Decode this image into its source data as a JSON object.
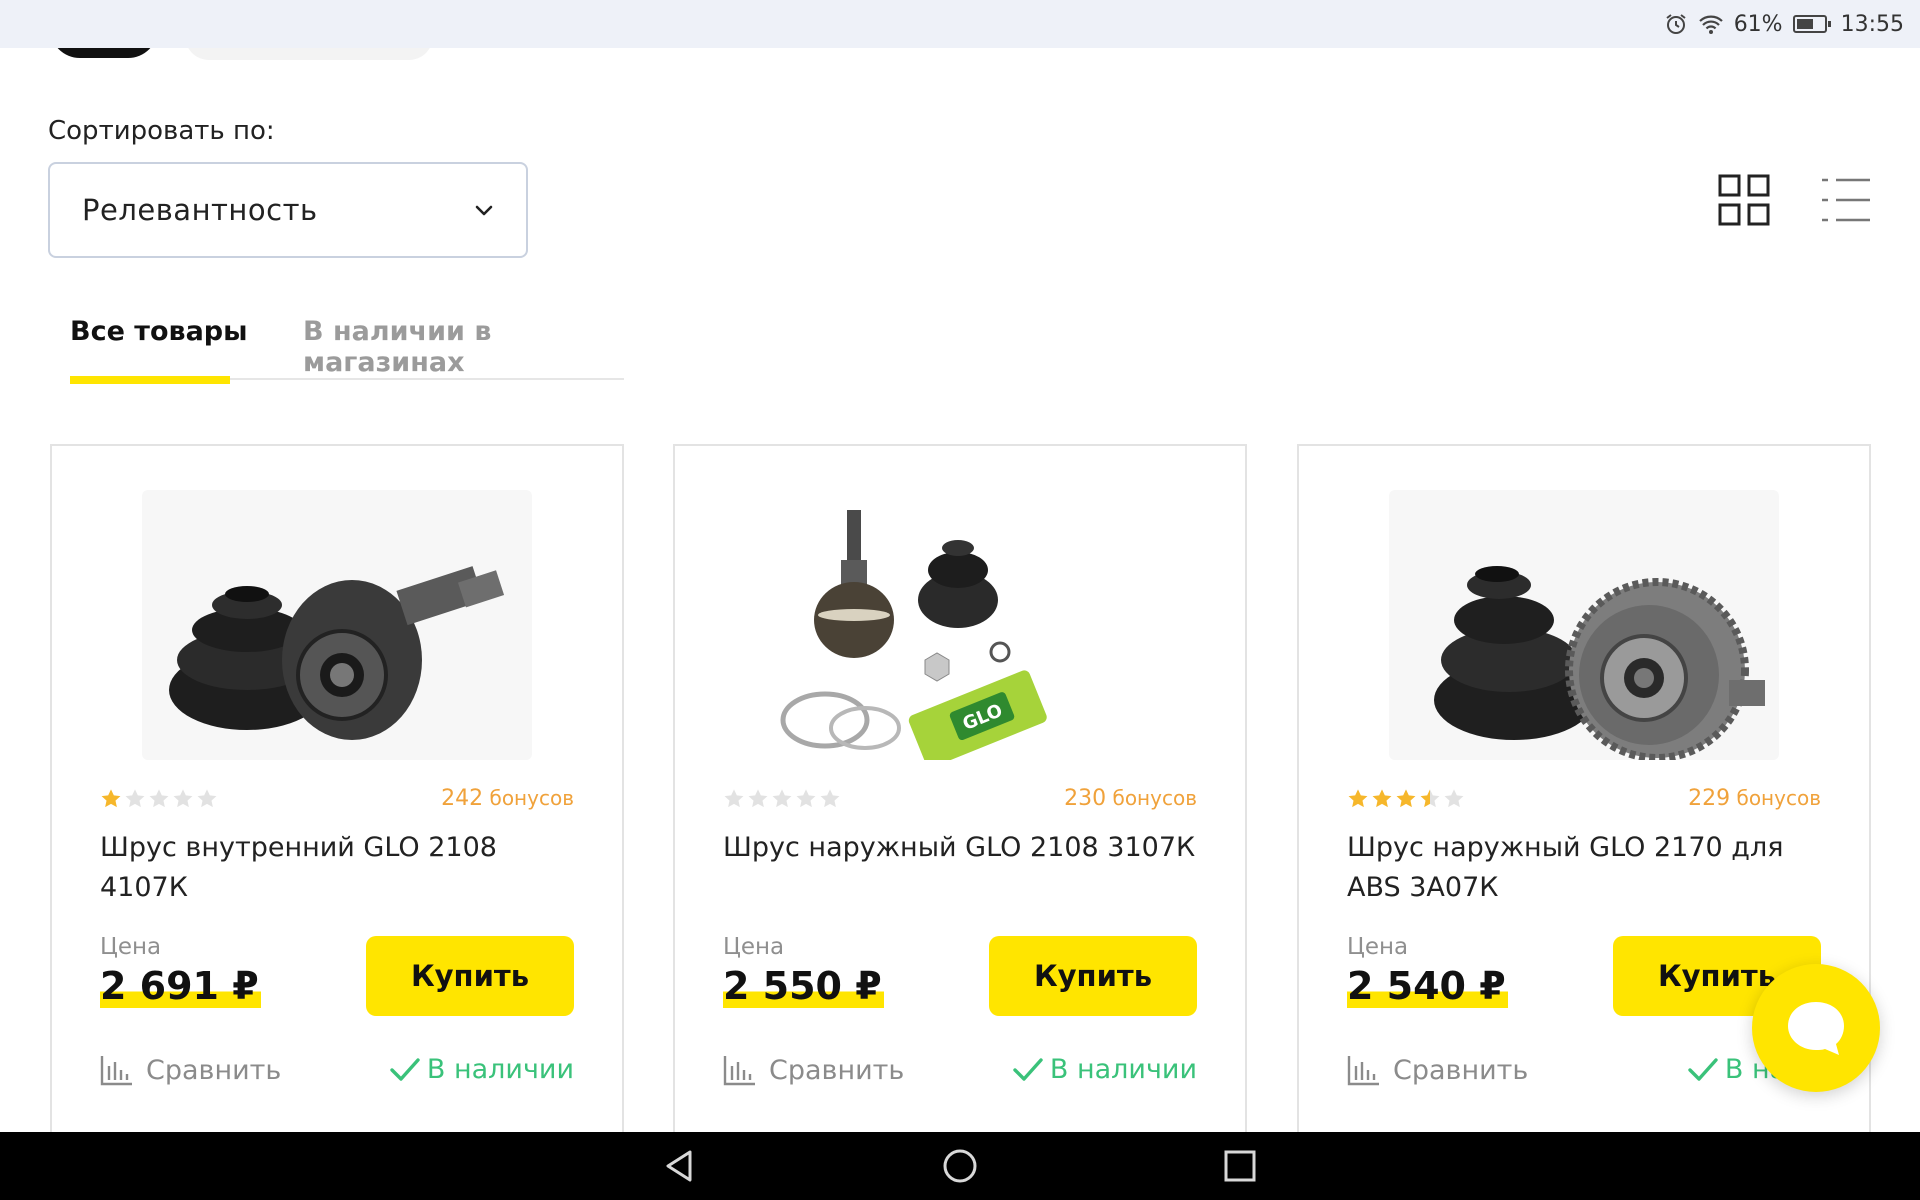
{
  "status_bar": {
    "battery_text": "61%",
    "battery_level": 0.61,
    "time": "13:55",
    "icons": [
      "alarm-icon",
      "wifi-icon",
      "battery-icon"
    ]
  },
  "sort": {
    "label": "Сортировать по:",
    "selected": "Релевантность"
  },
  "view_toggle": {
    "options": [
      "grid-view-icon",
      "list-view-icon"
    ],
    "active": "grid"
  },
  "tabs": [
    {
      "label": "Все товары",
      "active": true
    },
    {
      "label": "В наличии в магазинах",
      "active": false
    }
  ],
  "products": [
    {
      "rating": 1,
      "bonus_value": "242",
      "bonus_unit": "бонусов",
      "title": "Шрус внутренний GLO 2108 4107К",
      "price_label": "Цена",
      "price": "2 691 ₽",
      "buy_label": "Купить",
      "compare_label": "Сравнить",
      "stock_label": "В наличии"
    },
    {
      "rating": 0,
      "bonus_value": "230",
      "bonus_unit": "бонусов",
      "title": "Шрус наружный GLO 2108 3107К",
      "price_label": "Цена",
      "price": "2 550 ₽",
      "buy_label": "Купить",
      "compare_label": "Сравнить",
      "stock_label": "В наличии"
    },
    {
      "rating": 3.5,
      "bonus_value": "229",
      "bonus_unit": "бонусов",
      "title": "Шрус наружный GLO 2170 для ABS 3А07К",
      "price_label": "Цена",
      "price": "2 540 ₽",
      "buy_label": "Купить",
      "compare_label": "Сравнить",
      "stock_label": "В нали"
    }
  ],
  "colors": {
    "accent": "#ffe500",
    "bonus": "#f0a23b",
    "in_stock": "#3ac27a",
    "star_filled": "#f6b72b",
    "star_empty": "#e2e2e2"
  },
  "nav_bar": {
    "icons": [
      "back-icon",
      "home-icon",
      "recents-icon"
    ]
  }
}
